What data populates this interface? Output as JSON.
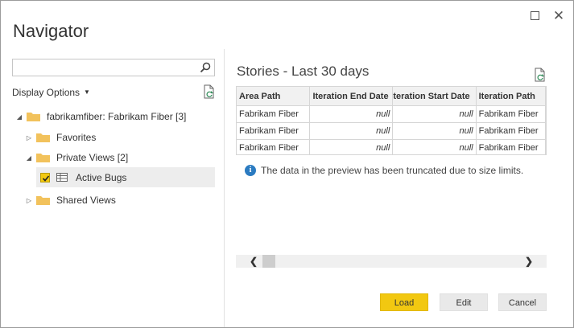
{
  "window": {
    "title": "Navigator"
  },
  "left": {
    "search": {
      "placeholder": "",
      "value": ""
    },
    "display_options": "Display Options",
    "tree": {
      "root": "fabrikamfiber: Fabrikam Fiber [3]",
      "favorites": "Favorites",
      "private_views": "Private Views [2]",
      "active_bugs": "Active Bugs",
      "shared_views": "Shared Views"
    }
  },
  "preview": {
    "title": "Stories - Last 30 days",
    "columns": [
      "Area Path",
      "Iteration End Date",
      "Iteration Start Date",
      "Iteration Path"
    ],
    "rows": [
      [
        "Fabrikam Fiber",
        "null",
        "null",
        "Fabrikam Fiber"
      ],
      [
        "Fabrikam Fiber",
        "null",
        "null",
        "Fabrikam Fiber"
      ],
      [
        "Fabrikam Fiber",
        "null",
        "null",
        "Fabrikam Fiber"
      ]
    ],
    "info": "The data in the preview has been truncated due to size limits."
  },
  "buttons": {
    "load": "Load",
    "edit": "Edit",
    "cancel": "Cancel"
  },
  "colors": {
    "accent": "#f2c811",
    "info": "#2b7bc1"
  }
}
